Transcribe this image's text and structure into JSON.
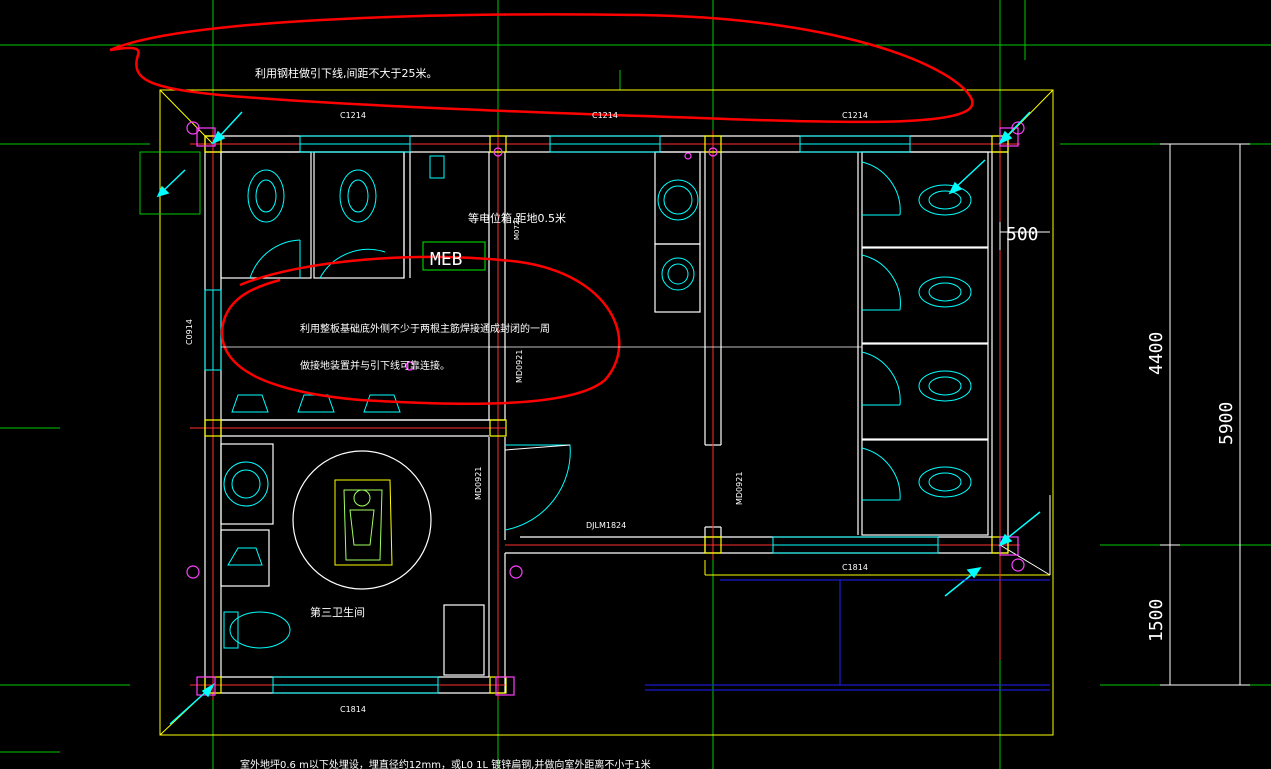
{
  "colors": {
    "background": "#000000",
    "grid": "#00c800",
    "wall": "#ffffff",
    "axis": "#ff3030",
    "column": "#ffff00",
    "window": "#00ffff",
    "fixture": "#00ffff",
    "door": "#00ffff",
    "magenta": "#ff40ff",
    "markup": "#ff0000",
    "blue": "#2020ff",
    "text": "#ffffff",
    "dimension": "#ffffff"
  },
  "annotations": {
    "top_note": "利用钢柱做引下线,间距不大于25米。",
    "meb_note": "等电位箱,距地0.5米",
    "meb_label": "MEB",
    "mid_note_line1": "利用整板基础底外侧不少于两根主筋焊接通成封闭的一周",
    "mid_note_line2": "做接地装置并与引下线可靠连接。",
    "room_name": "第三卫生间",
    "bottom_note": "室外地坪0.6 m以下处埋设，埋直径约12mm，或L0   1L   镀锌扁钢,并做向室外距离不小于1米"
  },
  "labels": {
    "window_c1214_a": "C1214",
    "window_c1214_b": "C1214",
    "window_c1214_c": "C1214",
    "window_c1814_right": "C1814",
    "window_c1814_bottom": "C1814",
    "window_c0914": "C0914",
    "door_md0921_a": "MD0921",
    "door_md0921_b": "MD0921",
    "door_md0921_c": "MD0921",
    "door_m0721": "M0721",
    "door_djlm": "DJLM1824"
  },
  "dimensions": {
    "d500": "500",
    "d4400": "4400",
    "d5900": "5900",
    "d1500": "1500"
  }
}
